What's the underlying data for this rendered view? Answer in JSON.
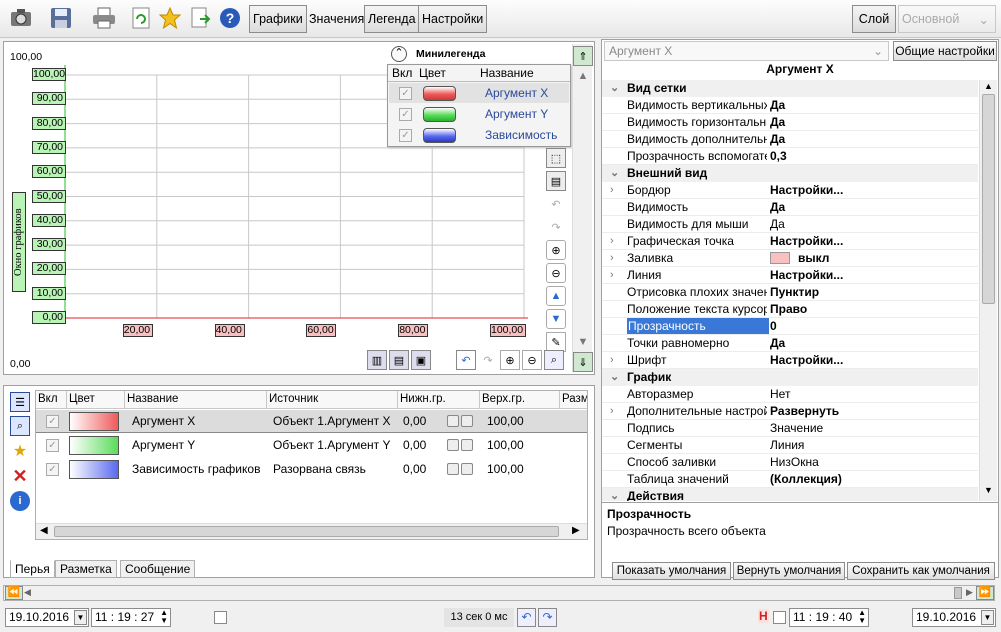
{
  "toolbar": {
    "icons": [
      "camera-icon",
      "save-icon",
      "print-icon",
      "refresh-icon",
      "star-icon",
      "export-icon",
      "help-icon"
    ],
    "tabs": [
      "Графики",
      "Значения",
      "Легенда",
      "Настройки"
    ],
    "right_tabs": {
      "layer": "Слой",
      "main": "Основной"
    }
  },
  "chart": {
    "y_top": "100,00",
    "y_bottom": "0,00",
    "y_axis_title": "Окно графиков",
    "y_ticks": [
      "100,00",
      "90,00",
      "80,00",
      "70,00",
      "60,00",
      "50,00",
      "40,00",
      "30,00",
      "20,00",
      "10,00",
      "0,00"
    ],
    "x_ticks": [
      "20,00",
      "40,00",
      "60,00",
      "80,00",
      "100,00"
    ],
    "minilegend": {
      "title": "Минилегенда",
      "headers": [
        "Вкл",
        "Цвет",
        "Название"
      ],
      "rows": [
        {
          "name": "Аргумент X",
          "color": "#ef5a5a",
          "checked": "✓"
        },
        {
          "name": "Аргумент Y",
          "color": "#5adc5a",
          "checked": "✓"
        },
        {
          "name": "Зависимость",
          "color": "#5a6aef",
          "checked": "✓"
        }
      ]
    }
  },
  "pens": {
    "headers": [
      "Вкл",
      "Цвет",
      "Название",
      "Источник",
      "Нижн.гр.",
      "Верх.гр.",
      "Разм"
    ],
    "rows": [
      {
        "on": "✓",
        "color": "#ef5a5a",
        "name": "Аргумент X",
        "source": "Объект 1.Аргумент X",
        "low": "0,00",
        "high": "100,00"
      },
      {
        "on": "✓",
        "color": "#5adc5a",
        "name": "Аргумент Y",
        "source": "Объект 1.Аргумент Y",
        "low": "0,00",
        "high": "100,00"
      },
      {
        "on": "✓",
        "color": "#5a6aef",
        "name": "Зависимость графиков",
        "source": "Разорвана связь",
        "low": "0,00",
        "high": "100,00"
      }
    ],
    "tabs": [
      "Перья",
      "Разметка",
      "Сообщение"
    ]
  },
  "props": {
    "object": "Аргумент X",
    "common_btn": "Общие настройки",
    "title": "Аргумент X",
    "rows": [
      {
        "k": "Вид сетки",
        "v": "",
        "type": "sec",
        "arr": "⌄"
      },
      {
        "k": "Видимость вертикальных",
        "v": "Да",
        "bold": true
      },
      {
        "k": "Видимость горизонтальных",
        "v": "Да",
        "bold": true
      },
      {
        "k": "Видимость дополнительных",
        "v": "Да",
        "bold": true
      },
      {
        "k": "Прозрачность вспомогательных",
        "v": "0,3",
        "bold": true
      },
      {
        "k": "Внешний вид",
        "v": "",
        "type": "sec",
        "arr": "⌄"
      },
      {
        "k": "Бордюр",
        "v": "Настройки...",
        "bold": true,
        "arr": "›"
      },
      {
        "k": "Видимость",
        "v": "Да",
        "bold": true
      },
      {
        "k": "Видимость для мыши",
        "v": "Да"
      },
      {
        "k": "Графическая точка",
        "v": "Настройки...",
        "bold": true,
        "arr": "›"
      },
      {
        "k": "Заливка",
        "v": "выкл",
        "bold": true,
        "arr": "›",
        "swatch": "#f8c0c0"
      },
      {
        "k": "Линия",
        "v": "Настройки...",
        "bold": true,
        "arr": "›"
      },
      {
        "k": "Отрисовка плохих значений",
        "v": "Пунктир",
        "bold": true
      },
      {
        "k": "Положение текста курсора",
        "v": "Право",
        "bold": true
      },
      {
        "k": "Прозрачность",
        "v": "0",
        "bold": true,
        "sel": true
      },
      {
        "k": "Точки равномерно",
        "v": "Да",
        "bold": true
      },
      {
        "k": "Шрифт",
        "v": "Настройки...",
        "bold": true,
        "arr": "›"
      },
      {
        "k": "График",
        "v": "",
        "type": "sec",
        "arr": "⌄"
      },
      {
        "k": "Авторазмер",
        "v": "Нет"
      },
      {
        "k": "Дополнительные настройки",
        "v": "Развернуть",
        "bold": true,
        "arr": "›"
      },
      {
        "k": "Подпись",
        "v": "Значение"
      },
      {
        "k": "Сегменты",
        "v": "Линия"
      },
      {
        "k": "Способ заливки",
        "v": "НизОкна"
      },
      {
        "k": "Таблица значений",
        "v": "(Коллекция)",
        "bold": true
      },
      {
        "k": "Действия",
        "v": "",
        "type": "sec",
        "arr": "⌄"
      }
    ],
    "desc_title": "Прозрачность",
    "desc_text": "Прозрачность всего объекта",
    "buttons": [
      "Показать умолчания",
      "Вернуть умолчания",
      "Сохранить как умолчания"
    ]
  },
  "status": {
    "date_left": "19.10.2016",
    "time_left": "11 : 19 : 27",
    "elapsed": "13 сек 0 мс",
    "h_label": "H",
    "time_right": "11 : 19 : 40",
    "date_right": "19.10.2016"
  }
}
